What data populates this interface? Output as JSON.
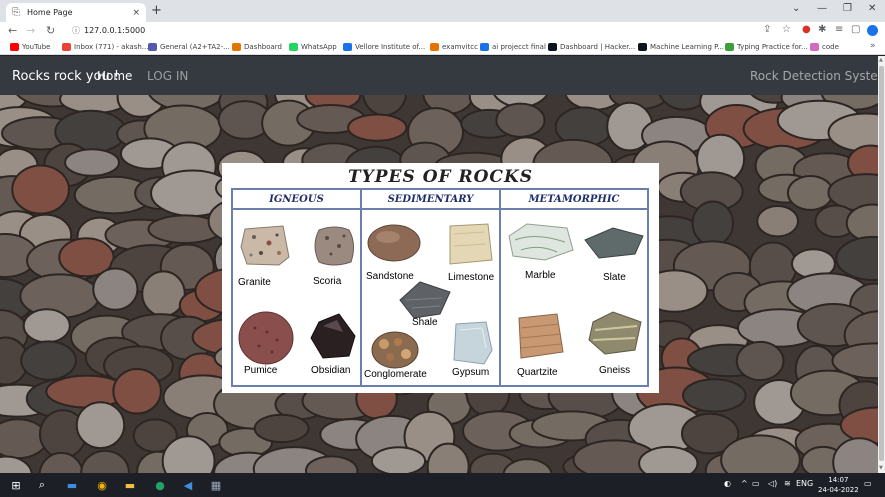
{
  "browser": {
    "tab_title": "Home Page",
    "tab_close": "×",
    "new_tab": "+",
    "url": "127.0.0.1:5000",
    "window_controls": [
      "⌄",
      "—",
      "❐",
      "✕"
    ],
    "bookmarks": [
      {
        "label": "YouTube",
        "color": "#ff0000"
      },
      {
        "label": "Inbox (771) - akash...",
        "color": "#ea4335"
      },
      {
        "label": "General (A2+TA2-...",
        "color": "#5558af"
      },
      {
        "label": "Dashboard",
        "color": "#e37400"
      },
      {
        "label": "WhatsApp",
        "color": "#25d366"
      },
      {
        "label": "Vellore Institute of...",
        "color": "#1a73e8"
      },
      {
        "label": "examvitcc",
        "color": "#e37400"
      },
      {
        "label": "ai projecct final",
        "color": "#1a73e8"
      },
      {
        "label": "Dashboard | Hacker...",
        "color": "#0e141e"
      },
      {
        "label": "Machine Learning P...",
        "color": "#0e141e"
      },
      {
        "label": "Typing Practice for...",
        "color": "#3c9f3c"
      },
      {
        "label": "code",
        "color": "#d36ac2"
      }
    ],
    "more": "»"
  },
  "app": {
    "brand": "Rocks rock you !",
    "nav_home": "Home",
    "nav_login": "LOG IN",
    "right_title": "Rock Detection System"
  },
  "infographic": {
    "title": "TYPES OF ROCKS",
    "columns": [
      {
        "heading": "IGNEOUS",
        "rocks": [
          "Granite",
          "Scoria",
          "Pumice",
          "Obsidian"
        ]
      },
      {
        "heading": "SEDIMENTARY",
        "rocks": [
          "Sandstone",
          "Limestone",
          "Shale",
          "Conglomerate",
          "Gypsum"
        ]
      },
      {
        "heading": "METAMORPHIC",
        "rocks": [
          "Marble",
          "Slate",
          "Quartzite",
          "Gneiss"
        ]
      }
    ]
  },
  "taskbar": {
    "tray_lang": "ENG",
    "time": "14:07",
    "date": "24-04-2022"
  }
}
